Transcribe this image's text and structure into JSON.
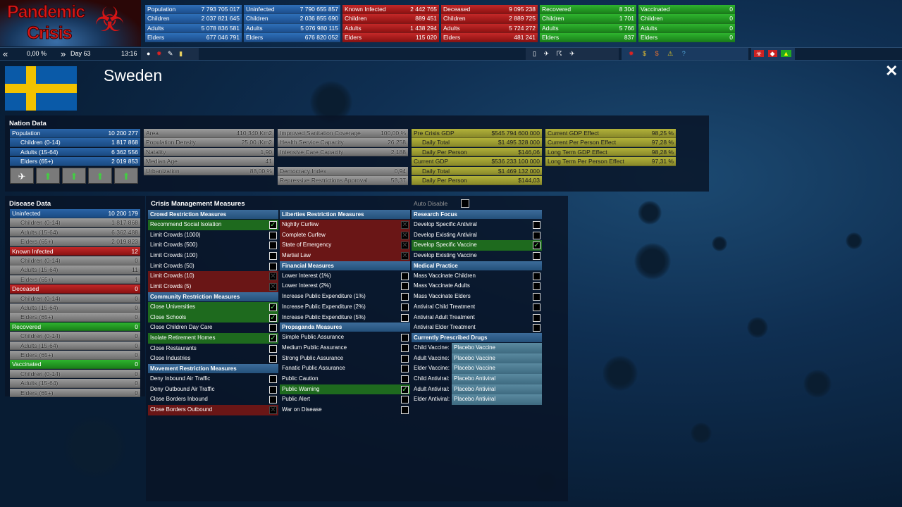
{
  "logo": {
    "line1": "Pandemic",
    "line2": "Crisis"
  },
  "stats": [
    {
      "color": "blue",
      "rows": [
        [
          "Population",
          "7 793 705 017"
        ],
        [
          "Children",
          "2 037 821 645"
        ],
        [
          "Adults",
          "5 078 836 581"
        ],
        [
          "Elders",
          "677 046 791"
        ]
      ]
    },
    {
      "color": "blue",
      "rows": [
        [
          "Uninfected",
          "7 790 655 857"
        ],
        [
          "Children",
          "2 036 855 690"
        ],
        [
          "Adults",
          "5 076 980 115"
        ],
        [
          "Elders",
          "676 820 052"
        ]
      ]
    },
    {
      "color": "red",
      "rows": [
        [
          "Known Infected",
          "2 442 765"
        ],
        [
          "Children",
          "889 451"
        ],
        [
          "Adults",
          "1 438 294"
        ],
        [
          "Elders",
          "115 020"
        ]
      ]
    },
    {
      "color": "red",
      "rows": [
        [
          "Deceased",
          "9 095 238"
        ],
        [
          "Children",
          "2 889 725"
        ],
        [
          "Adults",
          "5 724 272"
        ],
        [
          "Elders",
          "481 241"
        ]
      ]
    },
    {
      "color": "green",
      "rows": [
        [
          "Recovered",
          "8 304"
        ],
        [
          "Children",
          "1 701"
        ],
        [
          "Adults",
          "5 766"
        ],
        [
          "Elders",
          "837"
        ]
      ]
    },
    {
      "color": "green",
      "rows": [
        [
          "Vaccinated",
          "0"
        ],
        [
          "Children",
          "0"
        ],
        [
          "Adults",
          "0"
        ],
        [
          "Elders",
          "0"
        ]
      ]
    }
  ],
  "timebar": {
    "prev": "«",
    "percent": "0,00 %",
    "next": "»",
    "day": "Day 63",
    "time": "13:16"
  },
  "country": {
    "name": "Sweden",
    "close": "✕"
  },
  "nation": {
    "title": "Nation Data",
    "pop": [
      [
        "Population",
        "10 200 277"
      ],
      [
        "Children (0-14)",
        "1 817 868"
      ],
      [
        "Adults (15-64)",
        "6 362 556"
      ],
      [
        "Elders (65+)",
        "2 019 853"
      ]
    ],
    "geo": [
      [
        "Area",
        "410 340 Km2"
      ],
      [
        "Population Density",
        "25,00 /Km2"
      ],
      [
        "Natality",
        "1,90"
      ],
      [
        "Median Age",
        "41"
      ],
      [
        "Urbanization",
        "88,00 %"
      ]
    ],
    "health": [
      [
        "Improved Sanitation Coverage",
        "100,00 %"
      ],
      [
        "Health Service Capacity",
        "26 258"
      ],
      [
        "Intensive Care Capacity",
        "2 188"
      ]
    ],
    "gov": [
      [
        "Democracy Index",
        "0,94"
      ],
      [
        "Repressive Restrictions Approval",
        "58,37"
      ]
    ],
    "econ": [
      [
        "Pre Crisis GDP",
        "$545 794 600 000"
      ],
      [
        "Daily Total",
        "$1 495 328 000"
      ],
      [
        "Daily Per Person",
        "$146,06"
      ],
      [
        "Current GDP",
        "$536 233 100 000"
      ],
      [
        "Daily Total",
        "$1 469 132 000"
      ],
      [
        "Daily Per Person",
        "$144,03"
      ]
    ],
    "effects": [
      [
        "Current GDP Effect",
        "98,25 %"
      ],
      [
        "Current Per Person Effect",
        "97,28 %"
      ],
      [
        "Long Term GDP Effect",
        "98,28 %"
      ],
      [
        "Long Term Per Person Effect",
        "97,31 %"
      ]
    ]
  },
  "disease": {
    "title": "Disease Data",
    "groups": [
      {
        "c": "rb",
        "label": "Uninfected",
        "value": "10 200 179",
        "sub": [
          [
            "Children (0-14)",
            "1 817 868"
          ],
          [
            "Adults (15-64)",
            "6 362 488"
          ],
          [
            "Elders (65+)",
            "2 019 823"
          ]
        ]
      },
      {
        "c": "rr",
        "label": "Known Infected",
        "value": "12",
        "sub": [
          [
            "Children (0-14)",
            "0"
          ],
          [
            "Adults (15-64)",
            "11"
          ],
          [
            "Elders (65+)",
            "1"
          ]
        ]
      },
      {
        "c": "rr",
        "label": "Deceased",
        "value": "0",
        "sub": [
          [
            "Children (0-14)",
            "0"
          ],
          [
            "Adults (15-64)",
            "0"
          ],
          [
            "Elders (65+)",
            "0"
          ]
        ]
      },
      {
        "c": "rgr",
        "label": "Recovered",
        "value": "0",
        "sub": [
          [
            "Children (0-14)",
            "0"
          ],
          [
            "Adults (15-64)",
            "0"
          ],
          [
            "Elders (65+)",
            "0"
          ]
        ]
      },
      {
        "c": "rgr",
        "label": "Vaccinated",
        "value": "0",
        "sub": [
          [
            "Children (0-14)",
            "0"
          ],
          [
            "Adults (15-64)",
            "0"
          ],
          [
            "Elders (65+)",
            "0"
          ]
        ]
      }
    ]
  },
  "measures": {
    "title": "Crisis Management Measures",
    "auto_disable": "Auto Disable",
    "col1": [
      {
        "h": "Crowd Restriction Measures"
      },
      {
        "l": "Recommend Social Isolation",
        "s": "on"
      },
      {
        "l": "Limit Crowds (1000)"
      },
      {
        "l": "Limit Crowds (500)"
      },
      {
        "l": "Limit Crowds (100)"
      },
      {
        "l": "Limit Crowds (50)"
      },
      {
        "l": "Limit Crowds (10)",
        "s": "dis"
      },
      {
        "l": "Limit Crowds (5)",
        "s": "dis"
      },
      {
        "h": "Community Restriction Measures"
      },
      {
        "l": "Close Universities",
        "s": "on"
      },
      {
        "l": "Close Schools",
        "s": "on"
      },
      {
        "l": "Close Children Day Care"
      },
      {
        "l": "Isolate Retirement Homes",
        "s": "on"
      },
      {
        "l": "Close Restaurants"
      },
      {
        "l": "Close Industries"
      },
      {
        "h": "Movement Restriction Measures"
      },
      {
        "l": "Deny Inbound Air Traffic"
      },
      {
        "l": "Deny Outbound Air Traffic"
      },
      {
        "l": "Close Borders Inbound"
      },
      {
        "l": "Close Borders Outbound",
        "s": "dis"
      }
    ],
    "col2": [
      {
        "h": "Liberties Restriction Measures"
      },
      {
        "l": "Nightly Curfew",
        "s": "dis"
      },
      {
        "l": "Complete Curfew",
        "s": "dis"
      },
      {
        "l": "State of Emergency",
        "s": "dis"
      },
      {
        "l": "Martial Law",
        "s": "dis"
      },
      {
        "h": "Financial Measures"
      },
      {
        "l": "Lower Interest (1%)"
      },
      {
        "l": "Lower Interest (2%)"
      },
      {
        "l": "Increase Public Expenditure (1%)"
      },
      {
        "l": "Increase Public Expenditure (2%)"
      },
      {
        "l": "Increase Public Expenditure (5%)"
      },
      {
        "h": "Propaganda Measures"
      },
      {
        "l": "Simple Public Assurance"
      },
      {
        "l": "Medium Public Assurance"
      },
      {
        "l": "Strong Public Assurance"
      },
      {
        "l": "Fanatic Public Assurance"
      },
      {
        "l": "Public Caution"
      },
      {
        "l": "Public Warning",
        "s": "on"
      },
      {
        "l": "Public Alert"
      },
      {
        "l": "War on Disease"
      }
    ],
    "col3": [
      {
        "h": "Research Focus"
      },
      {
        "l": "Develop Specific Antiviral"
      },
      {
        "l": "Develop Existing Antiviral"
      },
      {
        "l": "Develop Specific Vaccine",
        "s": "on"
      },
      {
        "l": "Develop Existing Vaccine"
      },
      {
        "h": "Medical Practice"
      },
      {
        "l": "Mass Vaccinate Children"
      },
      {
        "l": "Mass Vaccinate Adults"
      },
      {
        "l": "Mass Vaccinate Elders"
      },
      {
        "l": "Antiviral Child Treatment"
      },
      {
        "l": "Antiviral Adult Treatment"
      },
      {
        "l": "Antiviral Elder Treatment"
      },
      {
        "h": "Currently Prescribed Drugs"
      }
    ],
    "drugs": [
      [
        "Child Vaccine:",
        "Placebo Vaccine"
      ],
      [
        "Adult Vaccine:",
        "Placebo Vaccine"
      ],
      [
        "Elder Vaccine:",
        "Placebo Vaccine"
      ],
      [
        "Child Antiviral:",
        "Placebo Antiviral"
      ],
      [
        "Adult Antiviral:",
        "Placebo Antiviral"
      ],
      [
        "Elder Antiviral:",
        "Placebo Antiviral"
      ]
    ]
  },
  "colors": {
    "accent_blue": "#1c4d8c",
    "red": "#8c1212",
    "green": "#1a801a",
    "olive": "#88882a",
    "flag_blue": "#0a5aa8",
    "flag_yellow": "#f2c200"
  }
}
